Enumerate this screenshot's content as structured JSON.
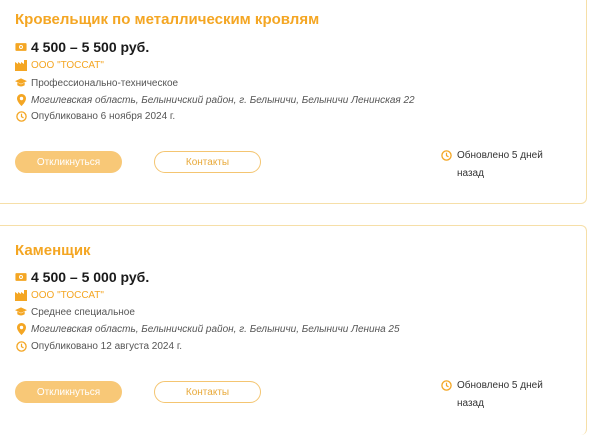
{
  "colors": {
    "accent": "#f4a623",
    "button_fill": "#f8c877",
    "border": "#f6dfa8"
  },
  "vacancies": [
    {
      "title": "Кровельщик по металлическим кровлям",
      "salary": "4 500 – 5 500 руб.",
      "company": "ООО \"ТОССАТ\"",
      "education": "Профессионально-техническое",
      "address": "Могилевская область, Белыничский район, г. Белыничи, Белыничи Ленинская 22",
      "published": "Опубликовано 6 ноября 2024 г.",
      "respond_label": "Откликнуться",
      "contacts_label": "Контакты",
      "updated": "Обновлено 5 дней назад"
    },
    {
      "title": "Каменщик",
      "salary": "4 500 – 5 000 руб.",
      "company": "ООО \"ТОССАТ\"",
      "education": "Среднее специальное",
      "address": "Могилевская область, Белыничский район, г. Белыничи, Белыничи Ленина 25",
      "published": "Опубликовано 12 августа 2024 г.",
      "respond_label": "Откликнуться",
      "contacts_label": "Контакты",
      "updated": "Обновлено 5 дней назад"
    }
  ],
  "icons": {
    "salary": "money-icon",
    "company": "factory-icon",
    "education": "graduation-cap-icon",
    "address": "location-pin-icon",
    "published": "clock-icon",
    "updated": "clock-icon"
  }
}
